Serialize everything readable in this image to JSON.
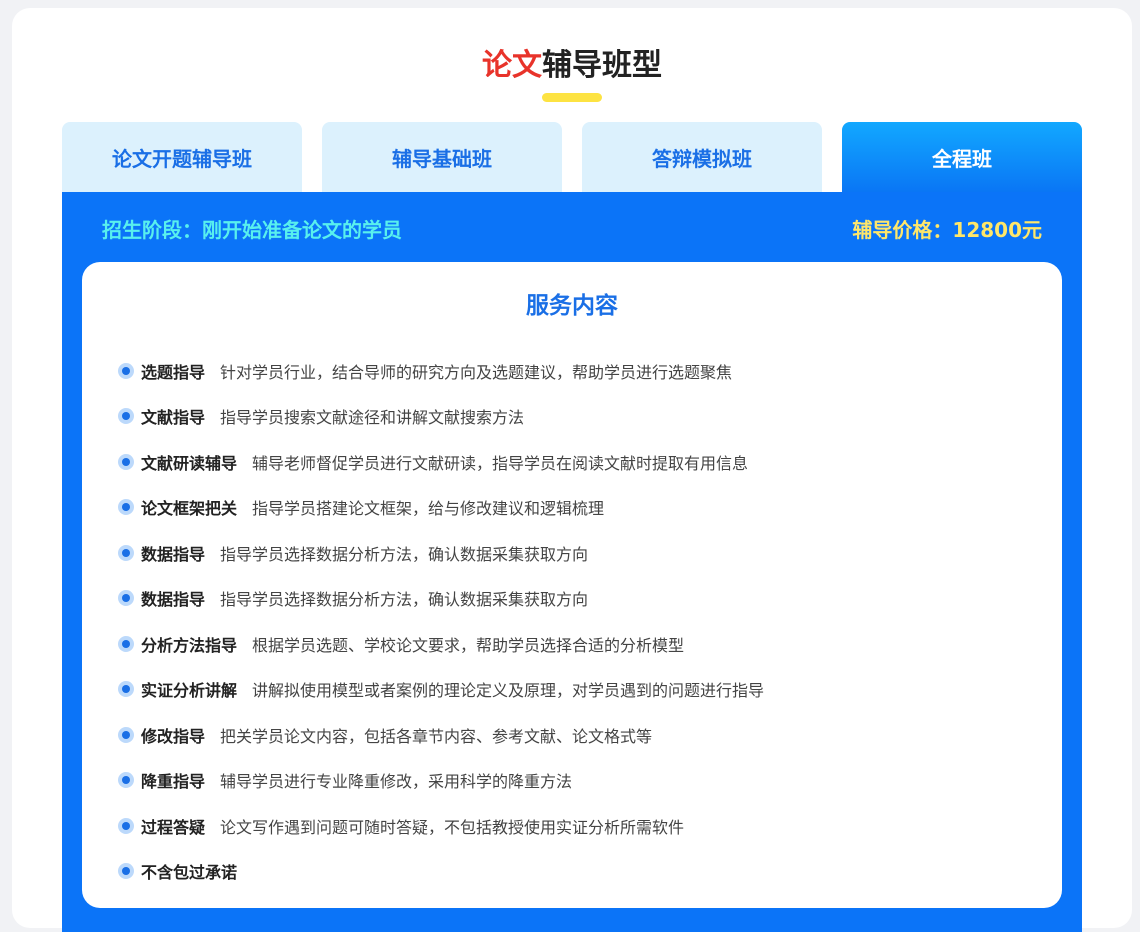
{
  "header": {
    "title_highlight": "论文",
    "title_rest": "辅导班型"
  },
  "tabs": [
    {
      "label": "论文开题辅导班",
      "active": false
    },
    {
      "label": "辅导基础班",
      "active": false
    },
    {
      "label": "答辩模拟班",
      "active": false
    },
    {
      "label": "全程班",
      "active": true
    }
  ],
  "panel": {
    "stage": "招生阶段：刚开始准备论文的学员",
    "price": "辅导价格：12800元",
    "services_title": "服务内容",
    "items": [
      {
        "name": "选题指导",
        "desc": "针对学员行业，结合导师的研究方向及选题建议，帮助学员进行选题聚焦"
      },
      {
        "name": "文献指导",
        "desc": "指导学员搜索文献途径和讲解文献搜索方法"
      },
      {
        "name": "文献研读辅导",
        "desc": "辅导老师督促学员进行文献研读，指导学员在阅读文献时提取有用信息"
      },
      {
        "name": "论文框架把关",
        "desc": "指导学员搭建论文框架，给与修改建议和逻辑梳理"
      },
      {
        "name": "数据指导",
        "desc": "指导学员选择数据分析方法，确认数据采集获取方向"
      },
      {
        "name": "数据指导",
        "desc": "指导学员选择数据分析方法，确认数据采集获取方向"
      },
      {
        "name": "分析方法指导",
        "desc": "根据学员选题、学校论文要求，帮助学员选择合适的分析模型"
      },
      {
        "name": "实证分析讲解",
        "desc": "讲解拟使用模型或者案例的理论定义及原理，对学员遇到的问题进行指导"
      },
      {
        "name": "修改指导",
        "desc": "把关学员论文内容，包括各章节内容、参考文献、论文格式等"
      },
      {
        "name": "降重指导",
        "desc": "辅导学员进行专业降重修改，采用科学的降重方法"
      },
      {
        "name": "过程答疑",
        "desc": "论文写作遇到问题可随时答疑，不包括教授使用实证分析所需软件"
      },
      {
        "name": "不含包过承诺",
        "desc": ""
      }
    ]
  },
  "colors": {
    "accent_red": "#e8332a",
    "brand_blue": "#0b74f8",
    "tab_bg": "#dcf1fd",
    "stage_text": "#58f0ee",
    "price_text": "#ffe76a",
    "underline": "#fde342"
  },
  "icons": {
    "bullet": "bullet-dot-icon"
  }
}
